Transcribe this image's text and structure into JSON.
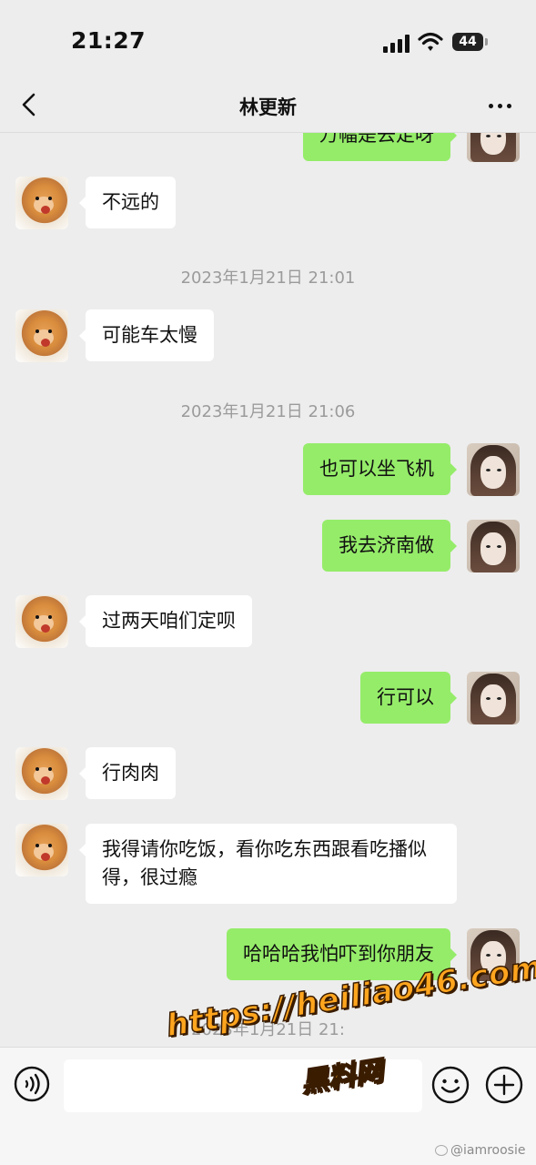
{
  "status_bar": {
    "time": "21:27",
    "battery": "44"
  },
  "header": {
    "title": "林更新"
  },
  "messages": [
    {
      "text": "万幅是去定呀"
    },
    {
      "text": "不远的"
    },
    {
      "text": "2023年1月21日 21:01"
    },
    {
      "text": "可能车太慢"
    },
    {
      "text": "2023年1月21日 21:06"
    },
    {
      "text": "也可以坐飞机"
    },
    {
      "text": "我去济南做"
    },
    {
      "text": "过两天咱们定呗"
    },
    {
      "text": "行可以"
    },
    {
      "text": "行肉肉"
    },
    {
      "text": "我得请你吃饭，看你吃东西跟看吃播似得，很过瘾"
    },
    {
      "text": "哈哈哈我怕吓到你朋友"
    },
    {
      "text": "2023年1月21日 21:"
    }
  ],
  "watermark": {
    "url": "https://heiliao46.com",
    "name": "黑料网",
    "weibo": "@iamroosie"
  },
  "colors": {
    "background": "#ededed",
    "outgoing_bubble": "#95ec69",
    "incoming_bubble": "#ffffff",
    "watermark": "#ffa51e"
  }
}
